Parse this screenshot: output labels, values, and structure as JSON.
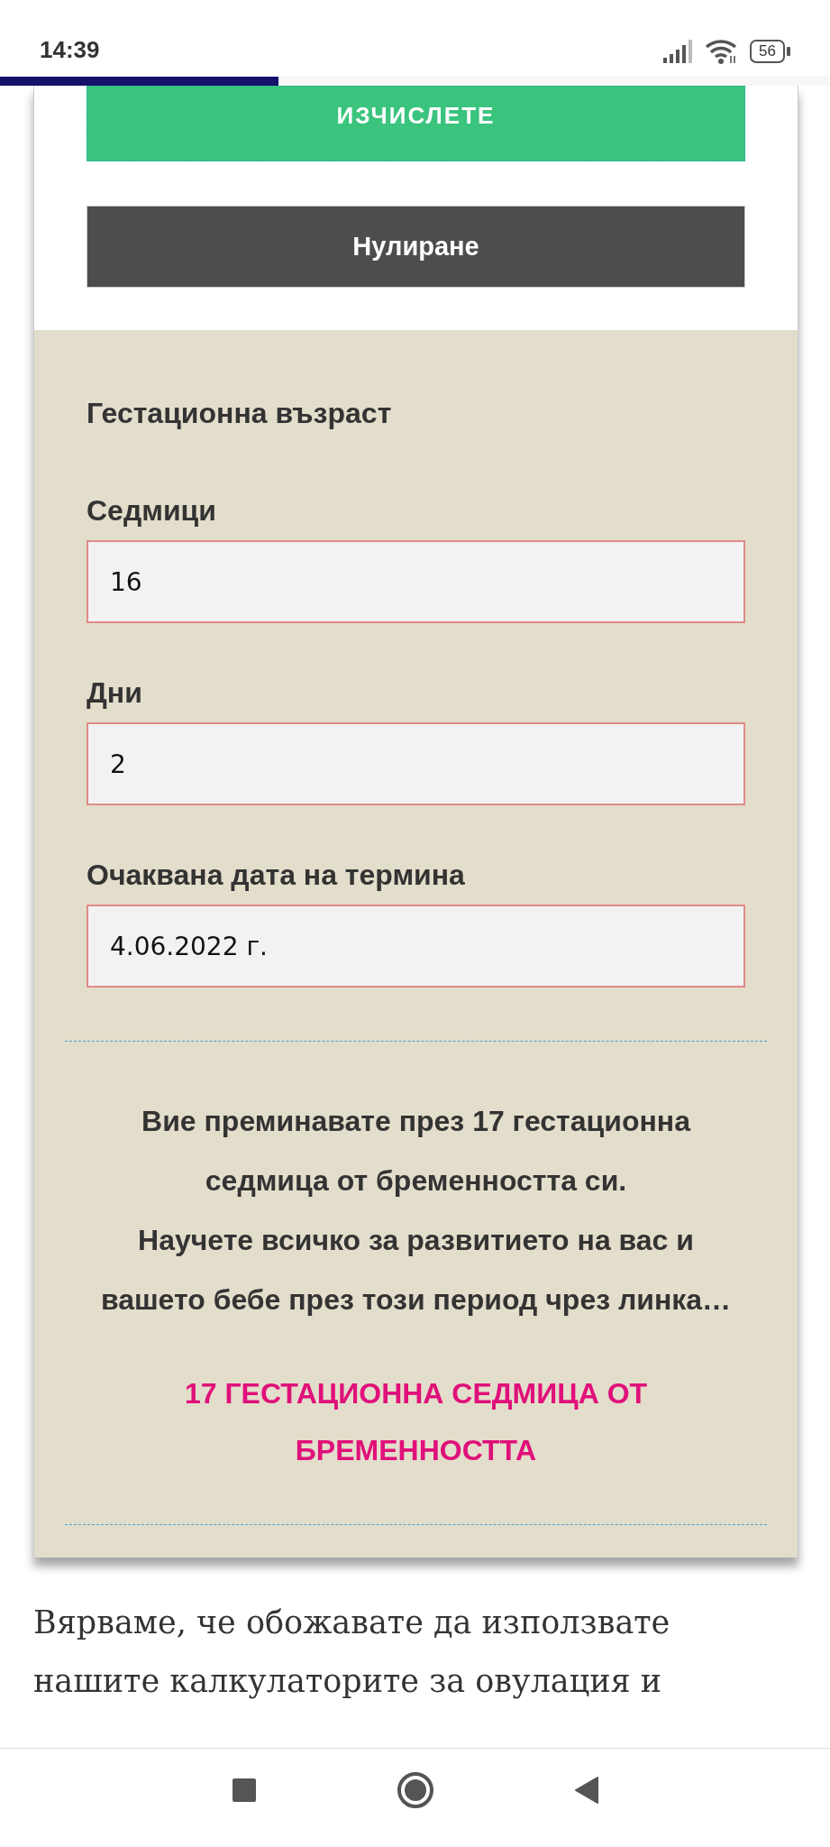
{
  "status_bar": {
    "time": "14:39",
    "battery": "56"
  },
  "page_progress": {
    "level": 0.335
  },
  "buttons": [
    {
      "kind": "calculate",
      "label": "ИЗЧИСЛЕТЕ"
    },
    {
      "kind": "reset",
      "label": "Нулиране"
    }
  ],
  "result": {
    "heading": "Гестационна възраст",
    "fields": [
      {
        "label": "Седмици",
        "value": "16"
      },
      {
        "label": "Дни",
        "value": "2"
      },
      {
        "label": "Очаквана дата на термина",
        "value": "4.06.2022 г."
      }
    ],
    "message": [
      "Вие преминавате през 17 гестационна седмица от бременността си.",
      "Научете всичко за развитието на вас и вашето бебе през този период чрез линка…"
    ],
    "link": "17 ГЕСТАЦИОННА СЕДМИЦА ОТ БРЕМЕННОСТТА"
  },
  "article": {
    "paragraph": "Вярваме, че обожавате да използвате нашите калкулаторите за овулация и"
  }
}
